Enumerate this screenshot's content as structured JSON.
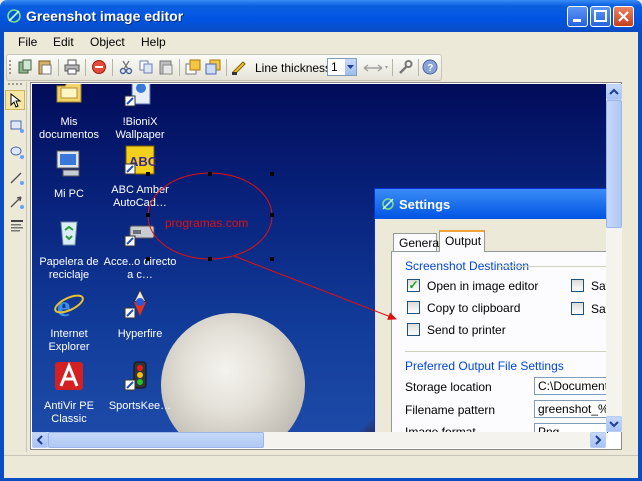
{
  "window": {
    "title": "Greenshot image editor"
  },
  "menu": [
    "File",
    "Edit",
    "Object",
    "Help"
  ],
  "toolbar": {
    "line_thickness_label": "Line thickness",
    "line_thickness_value": "1",
    "icons": [
      "copy-to-clipboard-icon",
      "paste-icon",
      "print-icon",
      "close-object-icon",
      "cut-icon",
      "copy-icon",
      "paste-object-icon",
      "bring-forward-icon",
      "send-backward-icon",
      "arrow-heads-icon",
      "settings-wrench-icon",
      "help-icon"
    ]
  },
  "tools": [
    "select-cursor-icon",
    "rectangle-tool-icon",
    "ellipse-tool-icon",
    "line-tool-icon",
    "arrow-tool-icon",
    "text-tool-icon"
  ],
  "desktop_icons": [
    {
      "label": "Mis documentos",
      "icon": "folder-icon"
    },
    {
      "label": "!BioniX Wallpaper",
      "icon": "wallpaper-app-icon"
    },
    {
      "label": "Mi PC",
      "icon": "computer-icon"
    },
    {
      "label": "ABC Amber AutoCad…",
      "icon": "abc-amber-icon"
    },
    {
      "label": "Papelera de reciclaje",
      "icon": "recycle-bin-icon"
    },
    {
      "label": "Acce..o directo a c…",
      "icon": "shortcut-drive-icon"
    },
    {
      "label": "Internet Explorer",
      "icon": "internet-explorer-icon"
    },
    {
      "label": "Hyperfire",
      "icon": "hyperfire-icon"
    },
    {
      "label": "AntiVir PE Classic",
      "icon": "antivir-icon"
    },
    {
      "label": "SportsKee…",
      "icon": "traffic-light-icon"
    }
  ],
  "annotation": {
    "text": "programas.com",
    "color": "#e01010"
  },
  "settings_dialog": {
    "title": "Settings",
    "tabs": [
      "General",
      "Output"
    ],
    "active_tab": "Output",
    "screenshot_destination": {
      "title": "Screenshot Destination",
      "options": [
        {
          "label": "Open in image editor",
          "checked": true
        },
        {
          "label": "Copy to clipboard",
          "checked": false
        },
        {
          "label": "Send to printer",
          "checked": false
        }
      ],
      "right_options": [
        "Sav",
        "Sav"
      ]
    },
    "preferred_output": {
      "title": "Preferred Output File Settings",
      "storage_location_label": "Storage location",
      "storage_location_value": "C:\\Documents",
      "filename_pattern_label": "Filename pattern",
      "filename_pattern_value": "greenshot_%Y",
      "image_format_label": "Image format",
      "image_format_value": "Png"
    }
  },
  "colors": {
    "titlebar": "#0154e3",
    "accent": "#0046d5",
    "annotation": "#e01010"
  }
}
